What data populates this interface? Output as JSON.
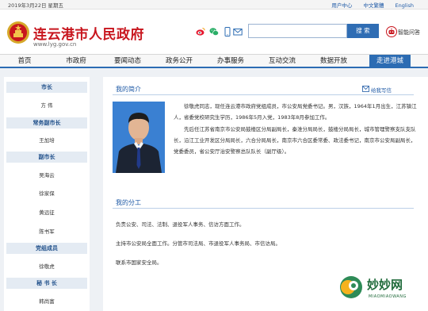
{
  "topbar": {
    "date": "2019年3月22日 星期五",
    "links": [
      "用户中心",
      "中文繁體",
      "English"
    ]
  },
  "header": {
    "title": "连云港市人民政府",
    "url": "www.lyg.gov.cn",
    "search_button": "搜 索",
    "search_placeholder": "",
    "smart_label": "智能问答",
    "social_icons": [
      "weibo-icon",
      "wechat-icon",
      "mobile-icon",
      "mail-icon"
    ]
  },
  "nav": {
    "items": [
      "首页",
      "市政府",
      "要闻动态",
      "政务公开",
      "办事服务",
      "互动交流",
      "数据开放",
      "走进港城"
    ],
    "active_index": 7
  },
  "sidebar": {
    "groups": [
      {
        "title": "市长",
        "names": [
          "方 伟"
        ]
      },
      {
        "title": "常务副市长",
        "names": [
          "王加培"
        ]
      },
      {
        "title": "副市长",
        "names": [
          "吴海云",
          "徐家保",
          "黄远征",
          "陈书军"
        ]
      },
      {
        "title": "党组成员",
        "names": [
          "徐敬虎"
        ]
      },
      {
        "title": "秘 书 长",
        "names": [
          "韩尚富"
        ]
      }
    ]
  },
  "content": {
    "intro_title": "我的简介",
    "write_label": "给我写信",
    "bio_paragraphs": [
      "徐敬虎同志，现任连云港市政府党组成员，市公安局党委书记。男，汉族，1964年1月出生，江苏镇江人，省委党校研究生学历，1986年5月入党，1983年8月参加工作。",
      "先后任江苏省南京市公安局鼓楼区分局副局长，秦淮分局局长，鼓楼分局局长，城市管理警察支队支队长，沿江工业开发区分局局长，六合分局局长，南京市六合区委常委、政法委书记，南京市公安局副局长，党委委员，省公安厅治安警察总队队长（副厅级）。"
    ],
    "duty_title": "我的分工",
    "duties": [
      "负责公安、司法、法制、退役军人事务、信访方面工作。",
      "主持市公安局全面工作。分管市司法局、市退役军人事务局、市信访局。",
      "联系市国家安全局。"
    ]
  },
  "watermark": {
    "text": "妙妙网",
    "sub": "MIAOMIAOWANG"
  },
  "colors": {
    "brand_red": "#c8161e",
    "nav_blue": "#2c6cb3",
    "sidebar_header_bg": "#e4ebf3",
    "page_bg": "#eef1f5"
  }
}
